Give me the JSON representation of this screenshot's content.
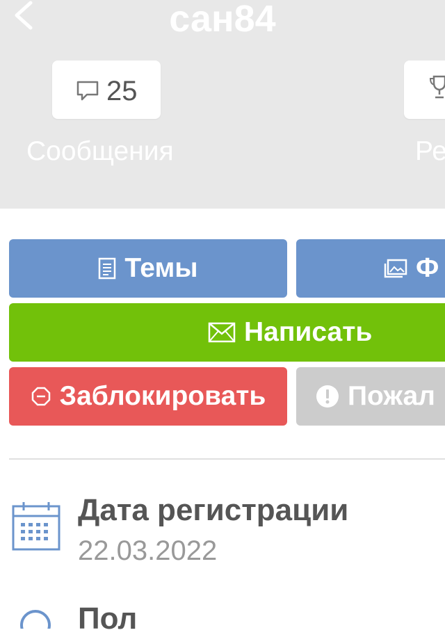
{
  "header": {
    "title": "сан84",
    "background": "#e8e8e8",
    "stats": [
      {
        "icon": "chat-bubble-icon",
        "count": "25",
        "label": "Сообщения"
      },
      {
        "icon": "trophy-icon",
        "count": "",
        "label": "Ре"
      }
    ]
  },
  "actions": {
    "themes": {
      "label": "Темы",
      "icon": "document-icon",
      "color": "#6b94cc"
    },
    "photo": {
      "label": "Ф",
      "icon": "image-icon",
      "color": "#6b94cc"
    },
    "write": {
      "label": "Написать",
      "icon": "envelope-icon",
      "color": "#72c10a"
    },
    "block": {
      "label": "Заблокировать",
      "icon": "block-octagon-icon",
      "color": "#e85858"
    },
    "report": {
      "label": "Пожал",
      "icon": "exclamation-circle-icon",
      "color": "#cccccc"
    }
  },
  "info": {
    "registration": {
      "label": "Дата регистрации",
      "value": "22.03.2022",
      "icon": "calendar-icon"
    },
    "gender": {
      "label": "Пол",
      "icon": "gender-icon"
    }
  }
}
